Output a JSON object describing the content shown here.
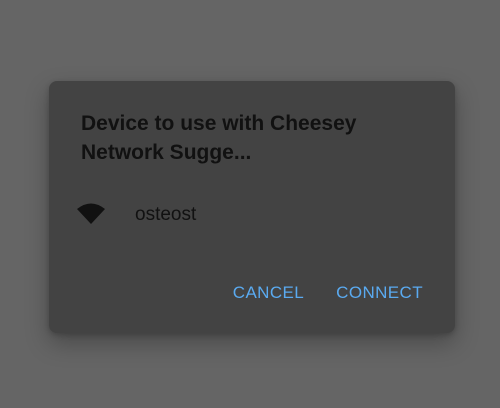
{
  "dialog": {
    "title": "Device to use with Cheesey Network Sugge...",
    "devices": [
      {
        "icon": "wifi-icon",
        "name": "osteost"
      }
    ],
    "cancel_label": "CANCEL",
    "connect_label": "CONNECT"
  },
  "colors": {
    "scrim": "#656565",
    "dialog_background": "#434343",
    "text": "#111111",
    "accent": "#5aaaf0"
  }
}
